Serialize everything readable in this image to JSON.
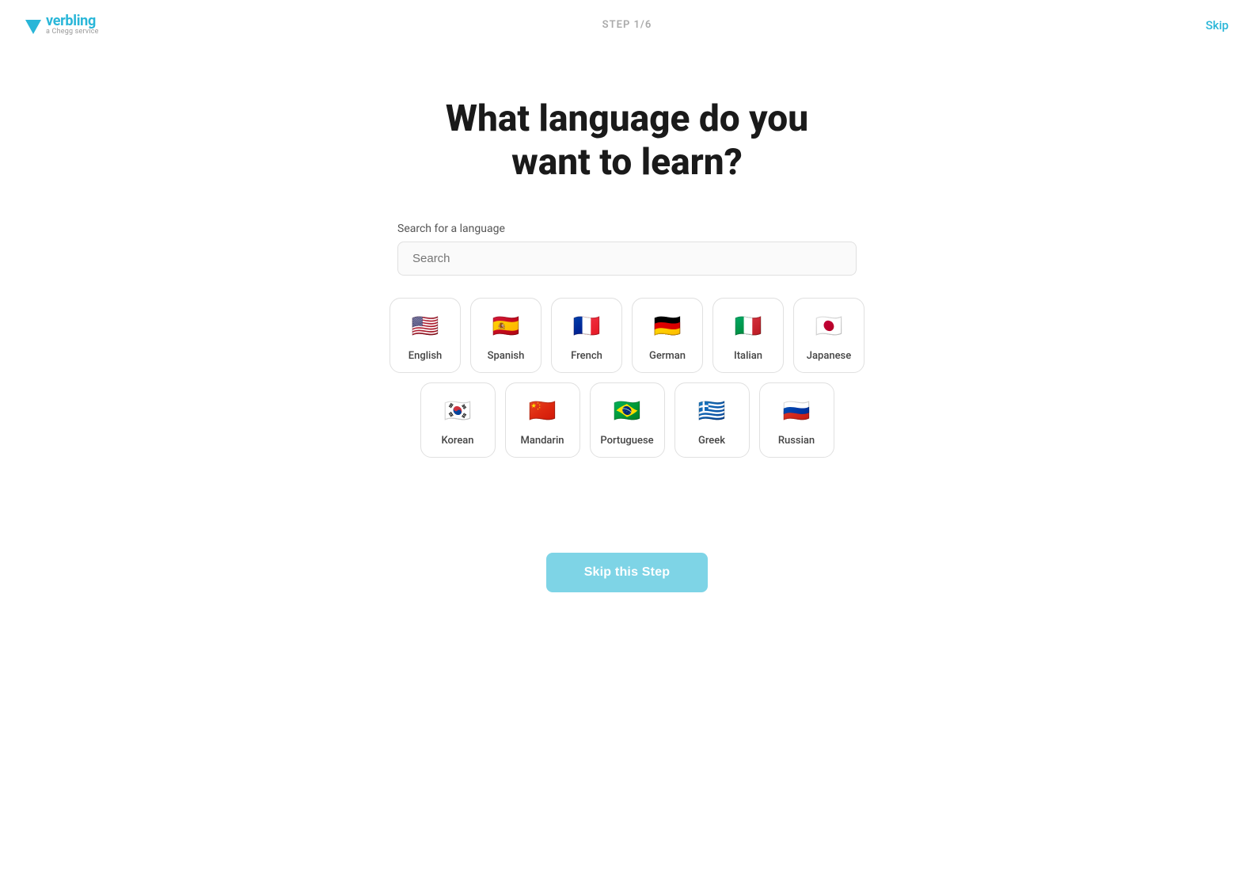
{
  "header": {
    "logo_brand": "verbling",
    "logo_sub": "a Chegg service",
    "step_label": "STEP  1/6",
    "skip_label": "Skip"
  },
  "main": {
    "title_line1": "What language do you",
    "title_line2": "want to learn?",
    "search_label": "Search for a language",
    "search_placeholder": "Search"
  },
  "languages": {
    "row1": [
      {
        "name": "English",
        "flag": "🇺🇸",
        "key": "english"
      },
      {
        "name": "Spanish",
        "flag": "🇪🇸",
        "key": "spanish"
      },
      {
        "name": "French",
        "flag": "🇫🇷",
        "key": "french"
      },
      {
        "name": "German",
        "flag": "🇩🇪",
        "key": "german"
      },
      {
        "name": "Italian",
        "flag": "🇮🇹",
        "key": "italian"
      },
      {
        "name": "Japanese",
        "flag": "🇯🇵",
        "key": "japanese"
      }
    ],
    "row2": [
      {
        "name": "Korean",
        "flag": "🇰🇷",
        "key": "korean"
      },
      {
        "name": "Mandarin",
        "flag": "🇨🇳",
        "key": "mandarin"
      },
      {
        "name": "Portuguese",
        "flag": "🇧🇷",
        "key": "portuguese"
      },
      {
        "name": "Greek",
        "flag": "🇬🇷",
        "key": "greek"
      },
      {
        "name": "Russian",
        "flag": "🇷🇺",
        "key": "russian"
      }
    ]
  },
  "skip_step_label": "Skip this Step"
}
